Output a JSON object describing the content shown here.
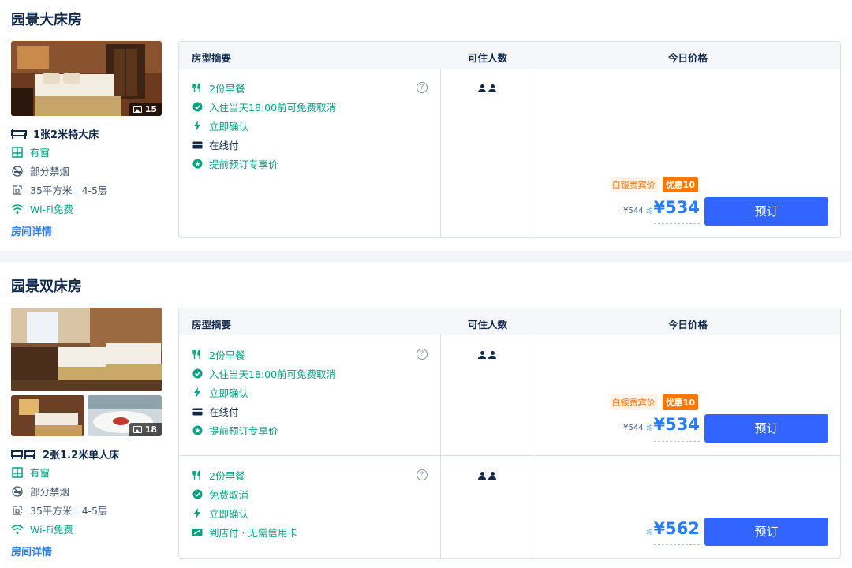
{
  "rooms": [
    {
      "title": "园景大床房",
      "photo_count": "15",
      "bed": "1张2米特大床",
      "window": "有窗",
      "smoking": "部分禁烟",
      "area": "35平方米 | 4-5层",
      "wifi": "Wi-Fi免费",
      "detail_link": "房间详情",
      "header": {
        "summary": "房型摘要",
        "guests": "可住人数",
        "price": "今日价格"
      },
      "plans": [
        {
          "breakfast": "2份早餐",
          "cancel": "入住当天18:00前可免费取消",
          "confirm": "立即确认",
          "payment": "在线付",
          "extra": "提前预订专享价",
          "help": "?",
          "member_tag": "白银贵宾价",
          "discount_tag": "优惠10",
          "old_price": "¥544",
          "avg": "均",
          "price": "¥534",
          "button": "预订"
        }
      ]
    },
    {
      "title": "园景双床房",
      "photo_count": "18",
      "bed": "2张1.2米单人床",
      "window": "有窗",
      "smoking": "部分禁烟",
      "area": "35平方米 | 4-5层",
      "wifi": "Wi-Fi免费",
      "detail_link": "房间详情",
      "header": {
        "summary": "房型摘要",
        "guests": "可住人数",
        "price": "今日价格"
      },
      "plans": [
        {
          "breakfast": "2份早餐",
          "cancel": "入住当天18:00前可免费取消",
          "confirm": "立即确认",
          "payment": "在线付",
          "extra": "提前预订专享价",
          "help": "?",
          "member_tag": "白银贵宾价",
          "discount_tag": "优惠10",
          "old_price": "¥544",
          "avg": "均",
          "price": "¥534",
          "button": "预订"
        },
        {
          "breakfast": "2份早餐",
          "cancel": "免费取消",
          "confirm": "立即确认",
          "payment": "到店付 · 无需信用卡",
          "help": "?",
          "avg": "均",
          "price": "¥562",
          "button": "预订"
        }
      ]
    }
  ],
  "colors": {
    "accent": "#287dfa",
    "button": "#3264ff",
    "green": "#00a383",
    "discount": "#ff7700"
  },
  "icons": [
    "bed-icon",
    "window-icon",
    "no-smoking-icon",
    "area-icon",
    "wifi-icon",
    "breakfast-icon",
    "check-circle-icon",
    "bolt-icon",
    "card-icon",
    "star-badge-icon",
    "cash-icon",
    "question-icon",
    "person-icon",
    "image-icon"
  ]
}
